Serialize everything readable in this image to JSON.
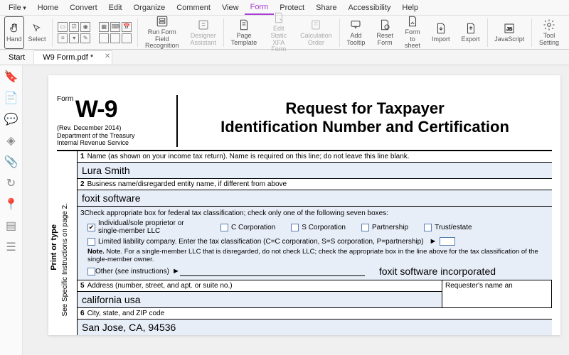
{
  "menu": {
    "file": "File",
    "home": "Home",
    "convert": "Convert",
    "edit": "Edit",
    "organize": "Organize",
    "comment": "Comment",
    "view": "View",
    "form": "Form",
    "protect": "Protect",
    "share": "Share",
    "accessibility": "Accessibility",
    "help": "Help"
  },
  "ribbon": {
    "hand": "Hand",
    "select": "Select",
    "recognition": "Run Form Field\nRecognition",
    "designer": "Designer\nAssistant",
    "pagetpl": "Page\nTemplate",
    "editstatic": "Edit Static\nXFA Form",
    "calcorder": "Calculation\nOrder",
    "addtooltip": "Add\nTooltip",
    "resetform": "Reset\nForm",
    "formtosheet": "Form to\nsheet",
    "import": "Import",
    "export": "Export",
    "javascript": "JavaScript",
    "toolsetting": "Tool\nSetting"
  },
  "tabs": {
    "start": "Start",
    "doc": "W9 Form.pdf *"
  },
  "form": {
    "formword": "Form",
    "code": "W-9",
    "rev": "(Rev. December 2014)",
    "dept": "Department of the Treasury",
    "irs": "Internal Revenue Service",
    "title1": "Request for Taxpayer",
    "title2": "Identification Number and Certification",
    "vert1": "Print or type",
    "vert2": "See Specific Instructions on page 2.",
    "l1": "Name (as shown on your income tax return). Name is required on this line; do not leave this line blank.",
    "v1": "Lura Smith",
    "l2": "Business name/disregarded entity name, if different from above",
    "v2": "foxit software",
    "l3": "Check appropriate box for federal tax classification; check only one of the following seven boxes:",
    "c1": "Individual/sole proprietor or single-member LLC",
    "c2": "C Corporation",
    "c3": "S Corporation",
    "c4": "Partnership",
    "c5": "Trust/estate",
    "llc": "Limited liability company. Enter the tax classification (C=C corporation, S=S corporation, P=partnership)",
    "note": "Note. For a single-member LLC that is disregarded, do not check LLC; check the appropriate box in the line above for the tax classification of the single-member owner.",
    "other": "Other (see instructions)",
    "othertext": "foxit software incorporated",
    "l5": "Address (number, street, and apt. or suite no.)",
    "v5": "california usa",
    "l6": "City, state, and ZIP code",
    "v6": "San Jose, CA, 94536",
    "req": "Requester's name an"
  }
}
